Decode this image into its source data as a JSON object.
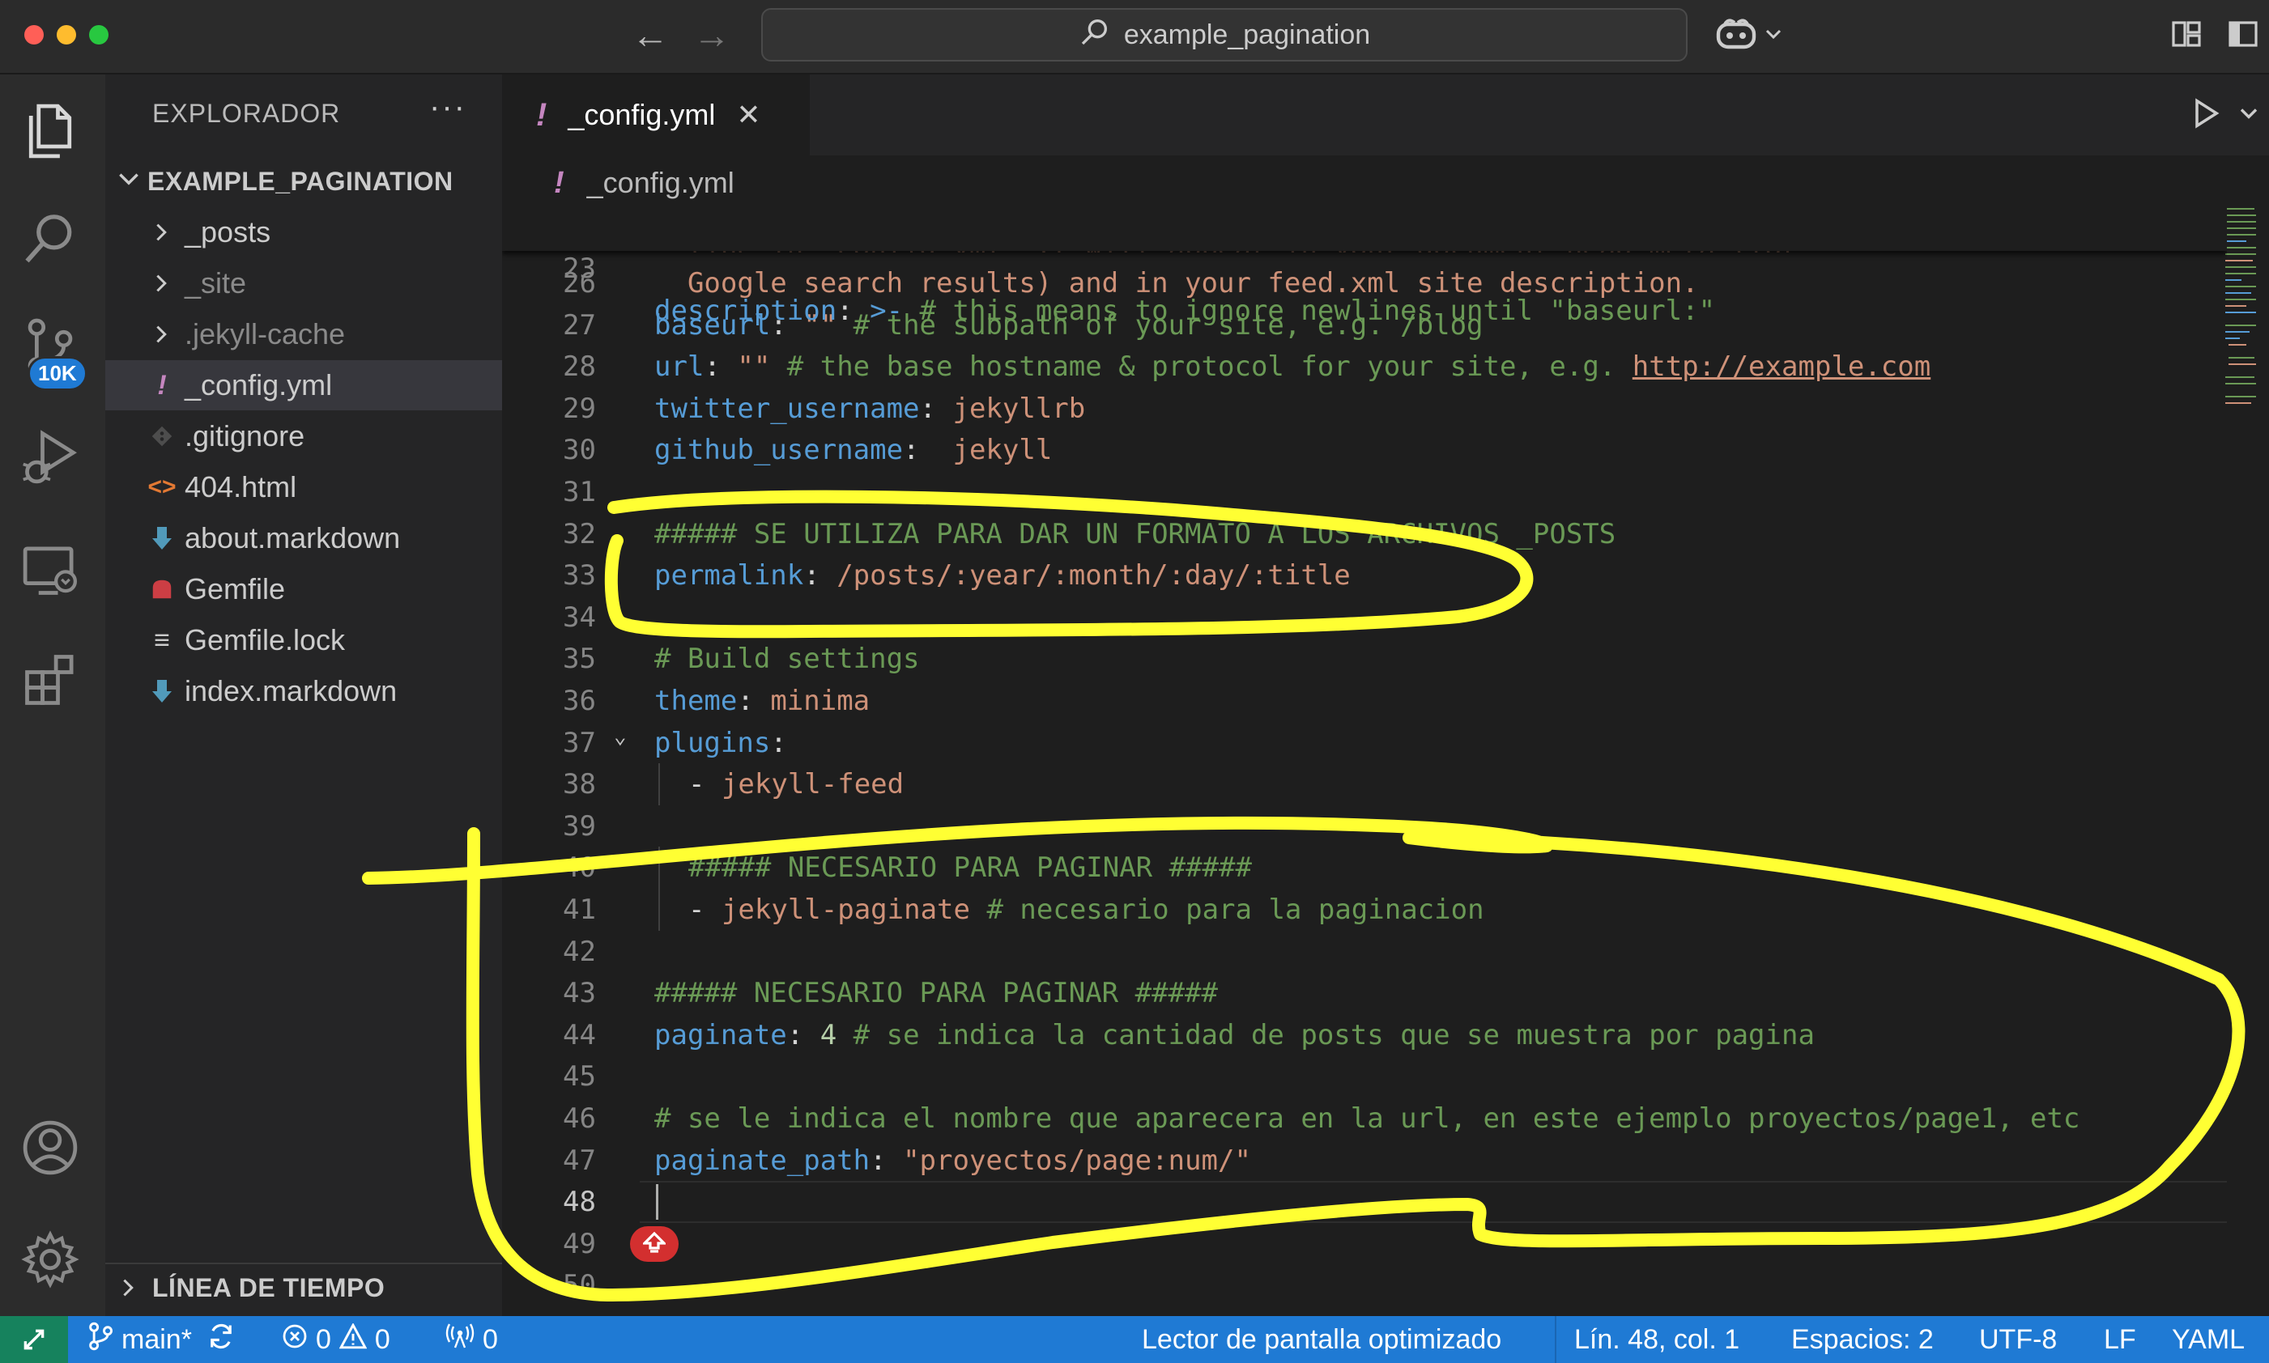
{
  "titlebar": {
    "search_text": "example_pagination"
  },
  "activitybar": {
    "badge": "10K",
    "icons": [
      "explorer-icon",
      "search-icon",
      "source-control-icon",
      "run-debug-icon",
      "remote-explorer-icon",
      "extensions-icon",
      "account-icon",
      "settings-gear-icon"
    ]
  },
  "sidebar": {
    "title": "EXPLORADOR",
    "more": "···",
    "project": "EXAMPLE_PAGINATION",
    "items": [
      {
        "label": "_posts",
        "type": "folder"
      },
      {
        "label": "_site",
        "type": "folder"
      },
      {
        "label": ".jekyll-cache",
        "type": "folder"
      },
      {
        "label": "_config.yml",
        "type": "yaml",
        "icon_glyph": "!"
      },
      {
        "label": ".gitignore",
        "type": "git"
      },
      {
        "label": "404.html",
        "type": "html",
        "icon_glyph": "<>"
      },
      {
        "label": "about.markdown",
        "type": "markdown"
      },
      {
        "label": "Gemfile",
        "type": "ruby"
      },
      {
        "label": "Gemfile.lock",
        "type": "lock",
        "icon_glyph": "≡"
      },
      {
        "label": "index.markdown",
        "type": "markdown"
      }
    ],
    "timeline": "LÍNEA DE TIEMPO"
  },
  "editor": {
    "tab_bang": "!",
    "tab_label": "_config.yml",
    "tab_close": "✕",
    "breadcrumb_bang": "!",
    "breadcrumb": "_config.yml",
    "sticky_line": {
      "num": "23",
      "key": "description",
      "punct": ": ",
      "op": ">-",
      "comment": " # this means to ignore newlines until \"baseurl:\""
    },
    "partial_line": "  line in _config.yml. It will appear in your document head meta (for",
    "lines": [
      {
        "num": "26",
        "parts": [
          {
            "t": "  Google search results) and in your feed.xml site description.",
            "c": "s"
          }
        ]
      },
      {
        "num": "27",
        "parts": [
          {
            "t": "baseurl",
            "c": "k"
          },
          {
            "t": ": ",
            "c": "w"
          },
          {
            "t": "\"\"",
            "c": "s"
          },
          {
            "t": " # the subpath of your site, e.g. /blog",
            "c": "c"
          }
        ]
      },
      {
        "num": "28",
        "parts": [
          {
            "t": "url",
            "c": "k"
          },
          {
            "t": ": ",
            "c": "w"
          },
          {
            "t": "\"\"",
            "c": "s"
          },
          {
            "t": " # the base hostname & protocol for your site, e.g. ",
            "c": "c"
          },
          {
            "t": "http://example.com",
            "c": "u"
          }
        ]
      },
      {
        "num": "29",
        "parts": [
          {
            "t": "twitter_username",
            "c": "k"
          },
          {
            "t": ": ",
            "c": "w"
          },
          {
            "t": "jekyllrb",
            "c": "s"
          }
        ]
      },
      {
        "num": "30",
        "parts": [
          {
            "t": "github_username",
            "c": "k"
          },
          {
            "t": ":  ",
            "c": "w"
          },
          {
            "t": "jekyll",
            "c": "s"
          }
        ]
      },
      {
        "num": "31",
        "parts": []
      },
      {
        "num": "32",
        "parts": [
          {
            "t": "##### SE UTILIZA PARA DAR UN FORMATO A LOS ARCHIVOS _POSTS",
            "c": "c"
          }
        ]
      },
      {
        "num": "33",
        "parts": [
          {
            "t": "permalink",
            "c": "k"
          },
          {
            "t": ": ",
            "c": "w"
          },
          {
            "t": "/posts/:year/:month/:day/:title",
            "c": "s"
          }
        ]
      },
      {
        "num": "34",
        "parts": []
      },
      {
        "num": "35",
        "parts": [
          {
            "t": "# Build settings",
            "c": "c"
          }
        ]
      },
      {
        "num": "36",
        "parts": [
          {
            "t": "theme",
            "c": "k"
          },
          {
            "t": ": ",
            "c": "w"
          },
          {
            "t": "minima",
            "c": "s"
          }
        ]
      },
      {
        "num": "37",
        "parts": [
          {
            "t": "plugins",
            "c": "k"
          },
          {
            "t": ":",
            "c": "w"
          }
        ]
      },
      {
        "num": "38",
        "indent": true,
        "parts": [
          {
            "t": "- ",
            "c": "w"
          },
          {
            "t": "jekyll-feed",
            "c": "s"
          }
        ]
      },
      {
        "num": "39",
        "parts": []
      },
      {
        "num": "40",
        "indent": true,
        "parts": [
          {
            "t": "##### NECESARIO PARA PAGINAR #####",
            "c": "c"
          }
        ]
      },
      {
        "num": "41",
        "indent": true,
        "parts": [
          {
            "t": "- ",
            "c": "w"
          },
          {
            "t": "jekyll-paginate",
            "c": "s"
          },
          {
            "t": " # necesario para la paginacion",
            "c": "c"
          }
        ]
      },
      {
        "num": "42",
        "parts": []
      },
      {
        "num": "43",
        "parts": [
          {
            "t": "##### NECESARIO PARA PAGINAR #####",
            "c": "c"
          }
        ]
      },
      {
        "num": "44",
        "parts": [
          {
            "t": "paginate",
            "c": "k"
          },
          {
            "t": ": ",
            "c": "w"
          },
          {
            "t": "4",
            "c": "n"
          },
          {
            "t": " # se indica la cantidad de posts que se muestra por pagina",
            "c": "c"
          }
        ]
      },
      {
        "num": "45",
        "parts": []
      },
      {
        "num": "46",
        "parts": [
          {
            "t": "# se le indica el nombre que aparecera en la url, en este ejemplo proyectos/page1, etc",
            "c": "c"
          }
        ]
      },
      {
        "num": "47",
        "parts": [
          {
            "t": "paginate_path",
            "c": "k"
          },
          {
            "t": ": ",
            "c": "w"
          },
          {
            "t": "\"proyectos/page:num/\"",
            "c": "s"
          }
        ]
      },
      {
        "num": "48",
        "parts": []
      },
      {
        "num": "49",
        "parts": []
      },
      {
        "num": "50",
        "parts": []
      }
    ]
  },
  "statusbar": {
    "branch": "main*",
    "errors": "0",
    "warnings": "0",
    "ports": "0",
    "reader": "Lector de pantalla optimizado",
    "position": "Lín. 48, col. 1",
    "spaces": "Espacios: 2",
    "encoding": "UTF-8",
    "eol": "LF",
    "language": "YAML"
  },
  "colors": {
    "annotation": "#ffff33",
    "accent": "#1f7ad4",
    "remote": "#16825d",
    "keyword": "#569cd6",
    "string": "#ce9178",
    "comment": "#6a9955"
  }
}
